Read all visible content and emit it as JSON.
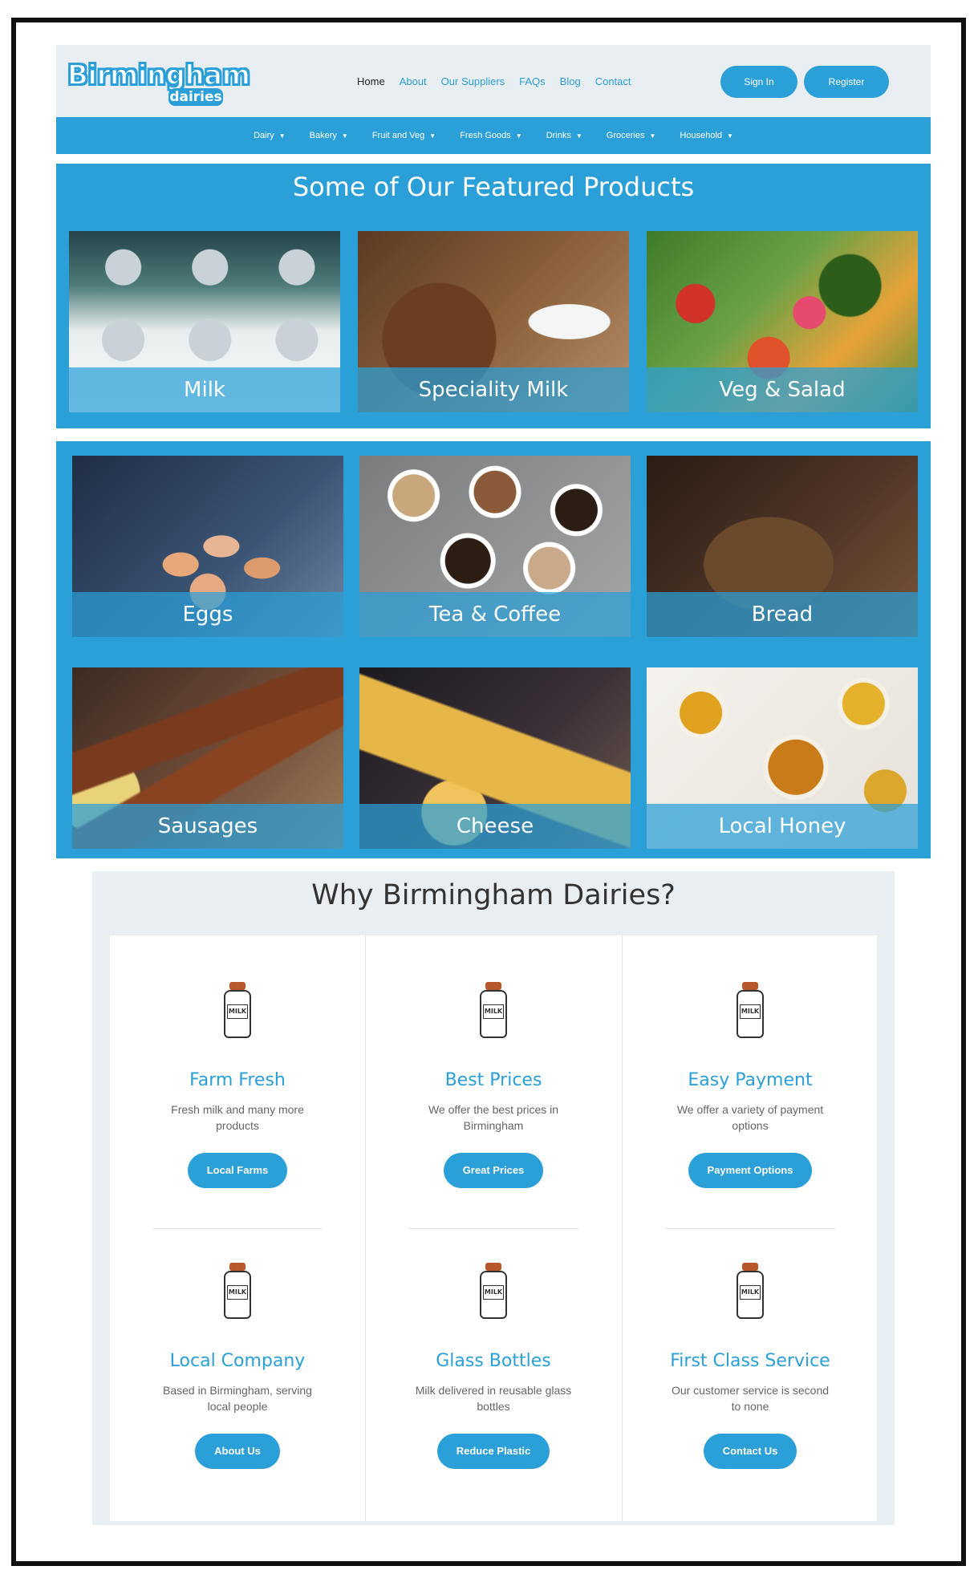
{
  "brand": {
    "word1": "Birmingham",
    "word2": "dairies"
  },
  "nav": {
    "links": [
      "Home",
      "About",
      "Our Suppliers",
      "FAQs",
      "Blog",
      "Contact"
    ],
    "sign_in": "Sign In",
    "register": "Register"
  },
  "categories": [
    "Dairy",
    "Bakery",
    "Fruit and Veg",
    "Fresh Goods",
    "Drinks",
    "Groceries",
    "Household"
  ],
  "featured": {
    "title": "Some of Our Featured Products",
    "items": [
      "Milk",
      "Speciality Milk",
      "Veg & Salad"
    ]
  },
  "products": [
    "Eggs",
    "Tea & Coffee",
    "Bread",
    "Sausages",
    "Cheese",
    "Local Honey"
  ],
  "why": {
    "title": "Why Birmingham Dairies?",
    "bottle_label": "MILK",
    "features": [
      {
        "title": "Farm Fresh",
        "desc": "Fresh milk and many more products",
        "button": "Local Farms"
      },
      {
        "title": "Best Prices",
        "desc": "We offer the best prices in Birmingham",
        "button": "Great Prices"
      },
      {
        "title": "Easy Payment",
        "desc": "We offer a variety of payment options",
        "button": "Payment Options"
      },
      {
        "title": "Local Company",
        "desc": "Based in Birmingham, serving local people",
        "button": "About Us"
      },
      {
        "title": "Glass Bottles",
        "desc": "Milk delivered in reusable glass bottles",
        "button": "Reduce Plastic"
      },
      {
        "title": "First Class Service",
        "desc": "Our customer service is second to none",
        "button": "Contact Us"
      }
    ]
  },
  "colors": {
    "accent": "#2a9fd8",
    "panel": "#e9eef3"
  }
}
